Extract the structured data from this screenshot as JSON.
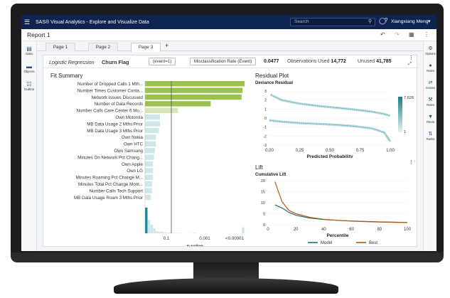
{
  "app": {
    "title": "SAS® Visual Analytics - Explore and Visualize Data",
    "search_placeholder": "Search",
    "user": "Xiangxiang Meng"
  },
  "report": {
    "title": "Report 1"
  },
  "left_rail": [
    {
      "label": "Data",
      "icon": "data-icon"
    },
    {
      "label": "Objects",
      "icon": "objects-icon"
    },
    {
      "label": "Outline",
      "icon": "outline-icon"
    }
  ],
  "right_rail": [
    {
      "label": "Options",
      "icon": "options-icon"
    },
    {
      "label": "Roles",
      "icon": "roles-icon"
    },
    {
      "label": "Actions",
      "icon": "actions-icon"
    },
    {
      "label": "Rules",
      "icon": "rules-icon"
    },
    {
      "label": "Filters",
      "icon": "filters-icon"
    },
    {
      "label": "Ranks",
      "icon": "ranks-icon"
    }
  ],
  "tabs": [
    "Page 1",
    "Page 2",
    "Page 3"
  ],
  "model": {
    "type": "Logistic Regression",
    "target": "Churn Flag",
    "event_button": "(event=1)",
    "metric_button": "Misclassification Rate (Event)",
    "metric_value": "0.0477",
    "obs_used_label": "Observations Used",
    "obs_used_value": "14,772",
    "unused_label": "Unused",
    "unused_value": "41,785"
  },
  "colors": {
    "topbar": "#0d2350",
    "bar_green": "#9cc14f",
    "bar_light_green": "#d7e6b8",
    "bar_teal": "#1b8a91",
    "bar_light_teal": "#cfe7e9",
    "line_model": "#1c6e74",
    "line_best": "#b55a14"
  },
  "fit_summary": {
    "title": "Fit Summary",
    "x_label": "p-value",
    "x_ticks": [
      "0.1",
      "0.001",
      "<0.00001"
    ],
    "bars": [
      {
        "label": "Number of Dropped Calls 1 Mth...",
        "value": 1.0,
        "shade": "green"
      },
      {
        "label": "Number Times Customer Conta...",
        "value": 0.98,
        "shade": "green"
      },
      {
        "label": "Network Issues Discussed",
        "value": 0.97,
        "shade": "green"
      },
      {
        "label": "Number of Data Records",
        "value": 0.66,
        "shade": "green"
      },
      {
        "label": "Number Calls Care Center 6 Mo...",
        "value": 0.33,
        "shade": "light-green"
      },
      {
        "label": "Own Motorola",
        "value": 0.15,
        "shade": "light-teal"
      },
      {
        "label": "MB Data Usage 2 Mths Prior",
        "value": 0.15,
        "shade": "light-teal"
      },
      {
        "label": "MB Data Usage 3 Mths Prior",
        "value": 0.14,
        "shade": "light-teal"
      },
      {
        "label": "Own Nokia",
        "value": 0.11,
        "shade": "light-teal"
      },
      {
        "label": "Own HTC",
        "value": 0.11,
        "shade": "light-teal"
      },
      {
        "label": "Own Samsung",
        "value": 0.1,
        "shade": "light-teal"
      },
      {
        "label": "Minutes On Network Pct Chang...",
        "value": 0.09,
        "shade": "light-teal"
      },
      {
        "label": "Own Apple",
        "value": 0.08,
        "shade": "light-teal"
      },
      {
        "label": "Own LG",
        "value": 0.08,
        "shade": "light-teal"
      },
      {
        "label": "Minutes Roaming Pct Change M...",
        "value": 0.08,
        "shade": "light-teal"
      },
      {
        "label": "Minutes Total Pct Change Mont...",
        "value": 0.07,
        "shade": "light-teal"
      },
      {
        "label": "Number Calls Tech Support",
        "value": 0.07,
        "shade": "light-teal"
      },
      {
        "label": "MB Data Usage Roam 3 Mths Prior",
        "value": 0.06,
        "shade": "light-teal"
      }
    ],
    "histogram": [
      0.95,
      0.5,
      0.32,
      0.18,
      0.08,
      0.05,
      0.06,
      0.03,
      0.02,
      0.03,
      0.02,
      0.01,
      0.02,
      0.01,
      0.0,
      0.0,
      0.01,
      0.0,
      0.02,
      0.0,
      0.0,
      0.0,
      0.0,
      0.0,
      0.0,
      0.0,
      0.0,
      0.0,
      0.0,
      0.0,
      0.0,
      0.0,
      0.0,
      0.0,
      0.0,
      0.0,
      0.22
    ]
  },
  "chart_data": [
    {
      "type": "scatter",
      "title": "Residual Plot",
      "subtitle": "Deviance Residual",
      "xlabel": "Predicted Probability",
      "x_ticks": [
        "0.00",
        "0.25",
        "0.50",
        "0.75",
        "1.00"
      ],
      "y_ticks": [
        "3",
        "2",
        "1",
        "0",
        "-1",
        "-2",
        "-3"
      ],
      "xlim": [
        0,
        1
      ],
      "ylim": [
        -3,
        3
      ],
      "legend_max": "7,628",
      "legend_min": "1",
      "upper_band": [
        [
          0.01,
          2.6
        ],
        [
          0.1,
          2.0
        ],
        [
          0.25,
          1.6
        ],
        [
          0.4,
          1.35
        ],
        [
          0.55,
          1.15
        ],
        [
          0.7,
          0.95
        ],
        [
          0.85,
          0.7
        ],
        [
          0.95,
          0.45
        ],
        [
          1.0,
          0.25
        ]
      ],
      "lower_band": [
        [
          0.0,
          -0.25
        ],
        [
          0.1,
          -0.4
        ],
        [
          0.25,
          -0.55
        ],
        [
          0.4,
          -0.65
        ],
        [
          0.55,
          -0.75
        ],
        [
          0.7,
          -0.9
        ],
        [
          0.85,
          -1.15
        ],
        [
          0.95,
          -1.6
        ],
        [
          1.0,
          -2.6
        ]
      ]
    },
    {
      "type": "line",
      "title": "Lift",
      "subtitle": "Cumulative Lift",
      "xlabel": "Percentile",
      "x_ticks": [
        "0",
        "20",
        "40",
        "60",
        "80",
        "100"
      ],
      "y_ticks": [
        "20",
        "15",
        "10",
        "5",
        "0"
      ],
      "xlim": [
        0,
        100
      ],
      "ylim": [
        0,
        20
      ],
      "series": [
        {
          "name": "Model",
          "x": [
            5,
            10,
            15,
            20,
            30,
            40,
            50,
            60,
            70,
            80,
            90,
            100
          ],
          "y": [
            9.0,
            7.6,
            5.6,
            4.3,
            3.0,
            2.4,
            2.0,
            1.7,
            1.5,
            1.3,
            1.15,
            1.0
          ]
        },
        {
          "name": "Best",
          "x": [
            5,
            10,
            15,
            20,
            30,
            40,
            50,
            60,
            70,
            80,
            90,
            100
          ],
          "y": [
            19.5,
            10.5,
            6.5,
            5.0,
            3.35,
            2.5,
            2.0,
            1.65,
            1.43,
            1.25,
            1.1,
            1.0
          ]
        }
      ]
    }
  ]
}
